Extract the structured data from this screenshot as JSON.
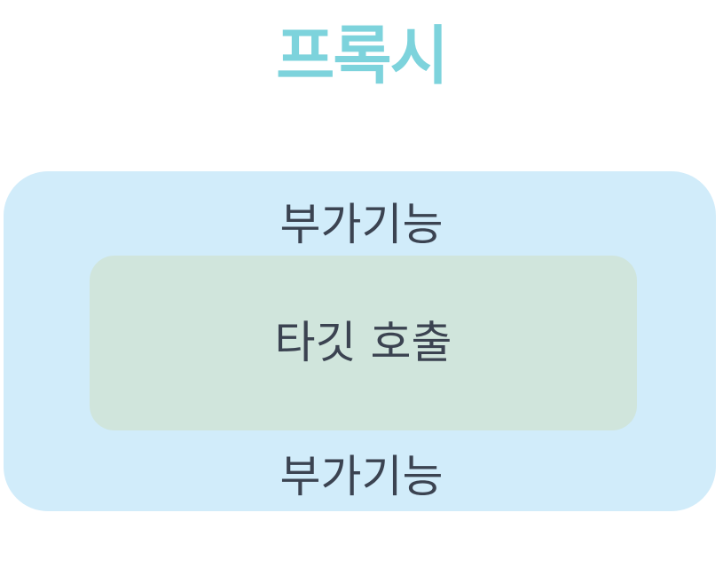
{
  "title": "프록시",
  "outer": {
    "label_top": "부가기능",
    "label_bottom": "부가기능"
  },
  "inner": {
    "label": "타깃 호출"
  },
  "colors": {
    "title": "#7dd3dc",
    "outer_fill": "#d1ecfa",
    "inner_fill": "#d0e5dc",
    "text": "#3b4351"
  }
}
